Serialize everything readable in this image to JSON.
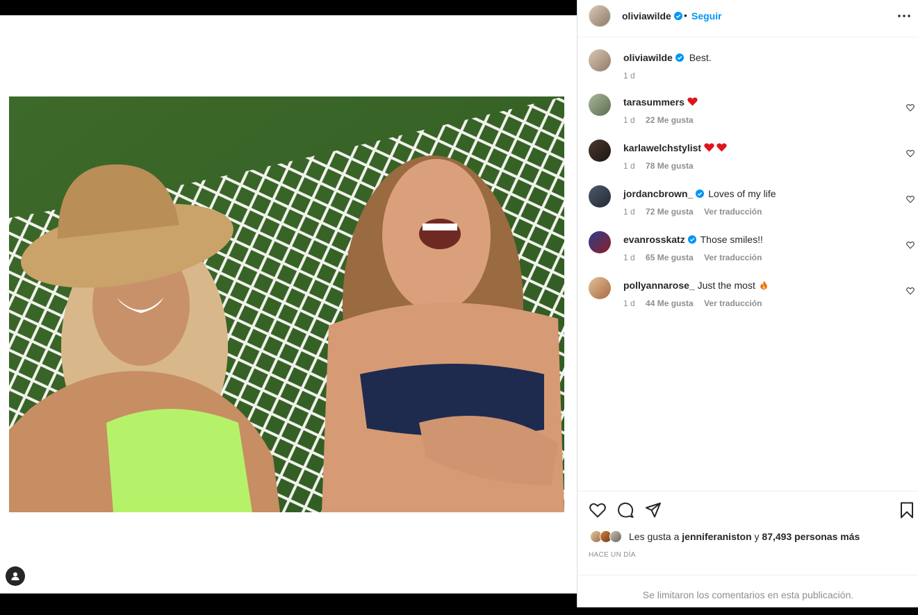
{
  "post": {
    "author": "oliviawilde",
    "follow_label": "Seguir",
    "separator": "•",
    "caption": "Best.",
    "caption_time": "1 d"
  },
  "comments": [
    {
      "user": "tarasummers",
      "verified": false,
      "text": "",
      "emoji": [
        "red-heart"
      ],
      "time": "1 d",
      "likes": "22 Me gusta",
      "translate": ""
    },
    {
      "user": "karlawelchstylist",
      "verified": false,
      "text": "",
      "emoji": [
        "red-heart",
        "red-heart"
      ],
      "time": "1 d",
      "likes": "78 Me gusta",
      "translate": ""
    },
    {
      "user": "jordancbrown_",
      "verified": true,
      "text": "Loves of my life",
      "emoji": [],
      "time": "1 d",
      "likes": "72 Me gusta",
      "translate": "Ver traducción"
    },
    {
      "user": "evanrosskatz",
      "verified": true,
      "text": "Those smiles!!",
      "emoji": [],
      "time": "1 d",
      "likes": "65 Me gusta",
      "translate": "Ver traducción"
    },
    {
      "user": "pollyannarose_",
      "verified": false,
      "text": "Just the most",
      "emoji": [
        "fire"
      ],
      "time": "1 d",
      "likes": "44 Me gusta",
      "translate": "Ver traducción"
    }
  ],
  "likes": {
    "prefix": "Les gusta a",
    "user": "jenniferaniston",
    "joiner": "y",
    "count": "87,493 personas más"
  },
  "time_ago": "HACE UN DÍA",
  "footer_note": "Se limitaron los comentarios en esta publicación.",
  "icons": {
    "like": "heart-icon",
    "comment": "comment-icon",
    "share": "share-icon",
    "save": "bookmark-icon",
    "more": "more-icon",
    "tag": "user-tag-icon",
    "verified": "verified-badge-icon"
  },
  "colors": {
    "accent": "#0095f6",
    "verified": "#0095f6",
    "muted": "#8e8e8e",
    "text": "#262626"
  }
}
